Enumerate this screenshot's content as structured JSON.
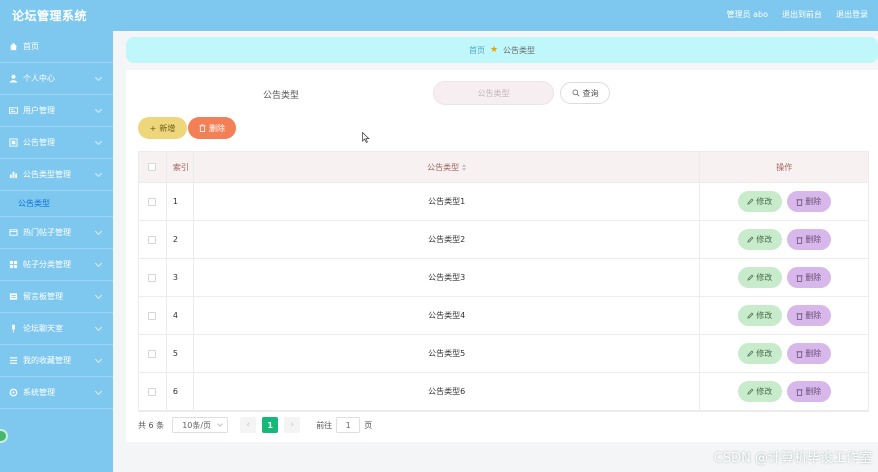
{
  "header": {
    "title": "论坛管理系统",
    "admin_label": "管理员 abo",
    "back_label": "退出到前台",
    "logout_label": "退出登录"
  },
  "sidebar": {
    "items": [
      {
        "label": "首页",
        "icon": "home-icon",
        "chevron": false
      },
      {
        "label": "个人中心",
        "icon": "user-icon",
        "chevron": true
      },
      {
        "label": "用户管理",
        "icon": "users-icon",
        "chevron": true
      },
      {
        "label": "公告管理",
        "icon": "notice-icon",
        "chevron": true
      },
      {
        "label": "公告类型管理",
        "icon": "chart-icon",
        "chevron": true
      }
    ],
    "sub_item": "公告类型",
    "items_after": [
      {
        "label": "热门帖子管理",
        "icon": "fire-icon",
        "chevron": true
      },
      {
        "label": "帖子分类管理",
        "icon": "grid-icon",
        "chevron": true
      },
      {
        "label": "留言板管理",
        "icon": "message-icon",
        "chevron": true
      },
      {
        "label": "论坛聊天室",
        "icon": "mic-icon",
        "chevron": true
      },
      {
        "label": "我的收藏管理",
        "icon": "list-icon",
        "chevron": true
      },
      {
        "label": "系统管理",
        "icon": "settings-icon",
        "chevron": true
      }
    ]
  },
  "breadcrumb": {
    "home": "首页",
    "current": "公告类型"
  },
  "search": {
    "label": "公告类型",
    "placeholder": "公告类型",
    "button": "查询"
  },
  "actions": {
    "add": "新增",
    "delete": "删除"
  },
  "table": {
    "headers": {
      "index": "索引",
      "name": "公告类型",
      "ops": "操作"
    },
    "edit_label": "修改",
    "delete_label": "删除",
    "rows": [
      {
        "index": "1",
        "name": "公告类型1"
      },
      {
        "index": "2",
        "name": "公告类型2"
      },
      {
        "index": "3",
        "name": "公告类型3"
      },
      {
        "index": "4",
        "name": "公告类型4"
      },
      {
        "index": "5",
        "name": "公告类型5"
      },
      {
        "index": "6",
        "name": "公告类型6"
      }
    ]
  },
  "pager": {
    "total": "共 6 条",
    "page_size": "10条/页",
    "prev": "‹",
    "current_page": "1",
    "next": "›",
    "goto_label": "前往",
    "goto_value": "1",
    "page_unit": "页"
  },
  "watermark": "CSDN @计算机毕设工作室",
  "colors": {
    "topbar": "#7ec8f0",
    "add_button": "#eed77b",
    "delete_button": "#f27f55",
    "edit_button": "#c7ebcb",
    "row_delete_button": "#d8b8ea",
    "active_page": "#17b978"
  }
}
